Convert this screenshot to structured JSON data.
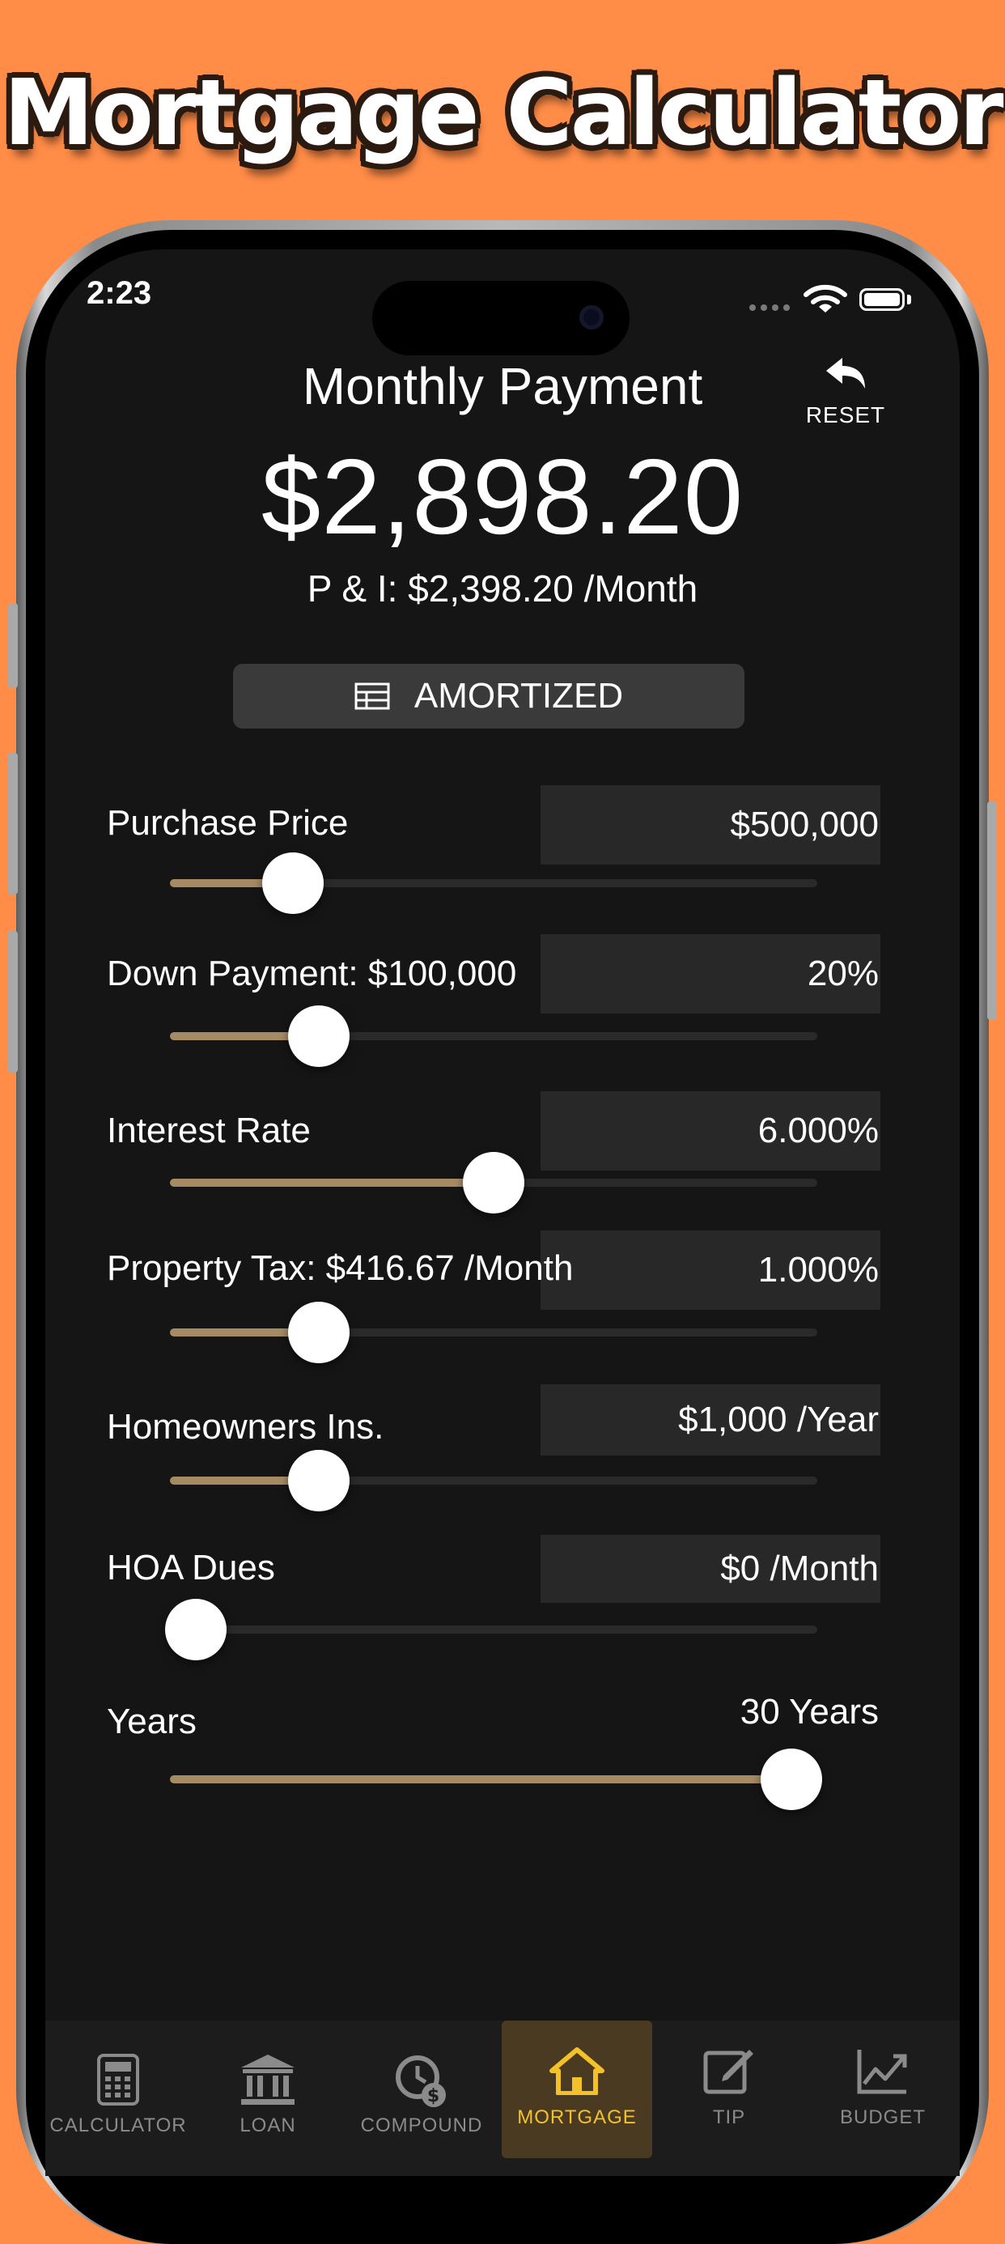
{
  "headline": "Mortgage Calculator",
  "status": {
    "time": "2:23"
  },
  "header": {
    "title": "Monthly Payment",
    "amount": "$2,898.20",
    "principal_interest": "P & I: $2,398.20 /Month",
    "reset_label": "RESET"
  },
  "amortized_button": {
    "label": "AMORTIZED"
  },
  "rows": [
    {
      "label": "Purchase Price",
      "value": "$500,000",
      "slider_fraction": 0.19
    },
    {
      "label": "Down Payment: $100,000",
      "value": "20%",
      "slider_fraction": 0.23
    },
    {
      "label": "Interest Rate",
      "value": "6.000%",
      "slider_fraction": 0.5
    },
    {
      "label": "Property Tax: $416.67 /Month",
      "value": "1.000%",
      "slider_fraction": 0.23
    },
    {
      "label": "Homeowners Ins.",
      "value": "$1,000 /Year",
      "slider_fraction": 0.23
    },
    {
      "label": "HOA Dues",
      "value": "$0 /Month",
      "slider_fraction": 0.04
    },
    {
      "label": "Years",
      "value": "30 Years",
      "slider_fraction": 0.96
    }
  ],
  "tabs": [
    {
      "label": "CALCULATOR",
      "icon": "calculator-icon"
    },
    {
      "label": "LOAN",
      "icon": "bank-icon"
    },
    {
      "label": "COMPOUND",
      "icon": "clock-dollar-icon"
    },
    {
      "label": "MORTGAGE",
      "icon": "house-icon",
      "active": true
    },
    {
      "label": "TIP",
      "icon": "edit-icon"
    },
    {
      "label": "BUDGET",
      "icon": "chart-line-icon"
    }
  ],
  "colors": {
    "background": "#FF8C47",
    "screen": "#151515",
    "slider_fill": "#A58A63",
    "tab_active": "#F3C22A",
    "tab_inactive": "#8B8B8B"
  }
}
